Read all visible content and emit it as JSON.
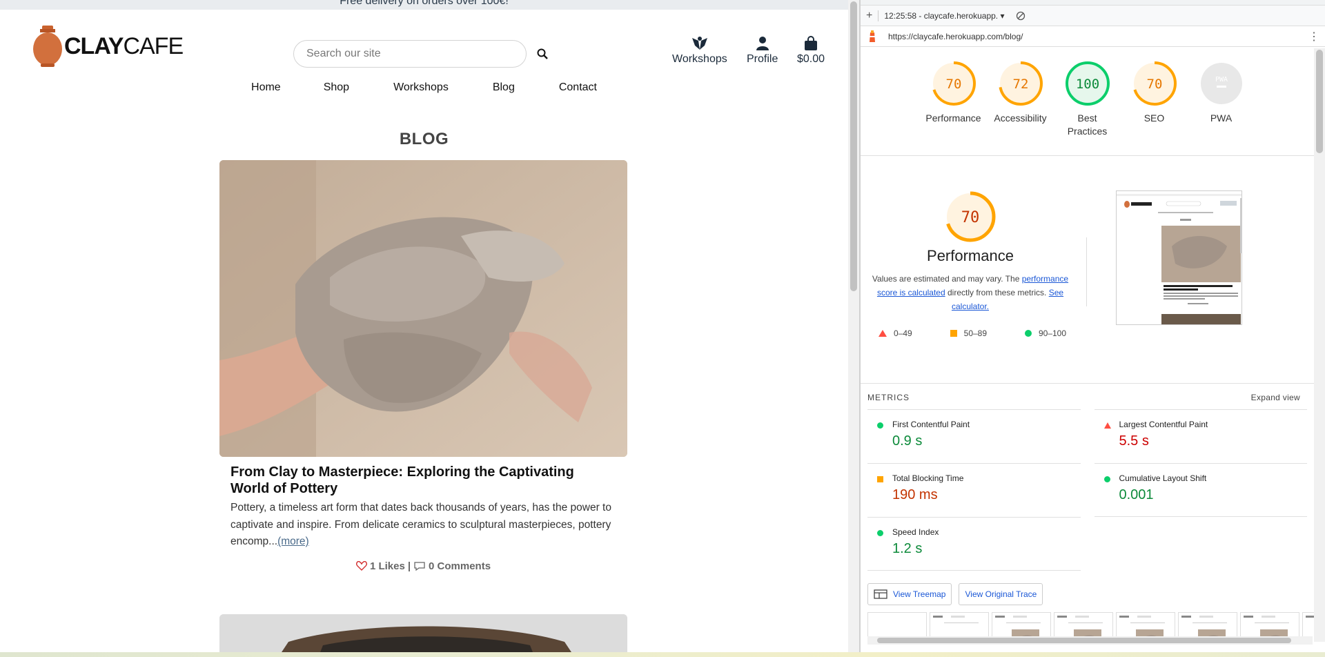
{
  "site": {
    "promo": "Free delivery on orders over 100€!",
    "logo": {
      "bold": "CLAY",
      "thin": "CAFE"
    },
    "search": {
      "placeholder": "Search our site"
    },
    "user_nav": {
      "workshops": "Workshops",
      "profile": "Profile",
      "cart": "$0.00"
    },
    "nav": [
      "Home",
      "Shop",
      "Workshops",
      "Blog",
      "Contact"
    ],
    "page_title": "BLOG",
    "post": {
      "title": "From Clay to Masterpiece: Exploring the Captivating World of Pottery",
      "excerpt": "Pottery, a timeless art form that dates back thousands of years, has the power to captivate and inspire. From delicate ceramics to sculptural masterpieces, pottery encomp...",
      "more": "(more)",
      "likes": "1 Likes",
      "separator": "|",
      "comments": "0 Comments"
    }
  },
  "devtools": {
    "toolbar": {
      "session": "12:25:58 - claycafe.herokuapp."
    },
    "url": "https://claycafe.herokuapp.com/blog/",
    "scores": [
      {
        "label": "Performance",
        "value": "70",
        "color": "#e67700"
      },
      {
        "label": "Accessibility",
        "value": "72",
        "color": "#e67700"
      },
      {
        "label": "Best Practices",
        "value": "100",
        "color": "#0c8a3a"
      },
      {
        "label": "SEO",
        "value": "70",
        "color": "#e67700"
      },
      {
        "label": "PWA",
        "value": "PWA",
        "color": "#9e9e9e"
      }
    ],
    "performance": {
      "score": "70",
      "title": "Performance",
      "desc_1": "Values are estimated and may vary. The ",
      "link_1": "performance score is calculated",
      "desc_2": " directly from these metrics. ",
      "link_2": "See calculator.",
      "legend": [
        "0–49",
        "50–89",
        "90–100"
      ]
    },
    "metrics_title": "METRICS",
    "expand_view": "Expand view",
    "metrics": [
      {
        "label": "First Contentful Paint",
        "value": "0.9 s",
        "status": "pass"
      },
      {
        "label": "Largest Contentful Paint",
        "value": "5.5 s",
        "status": "fail"
      },
      {
        "label": "Total Blocking Time",
        "value": "190 ms",
        "status": "average"
      },
      {
        "label": "Cumulative Layout Shift",
        "value": "0.001",
        "status": "pass"
      },
      {
        "label": "Speed Index",
        "value": "1.2 s",
        "status": "pass"
      }
    ],
    "buttons": {
      "treemap": "View Treemap",
      "trace": "View Original Trace"
    },
    "colors": {
      "pass": "#0c8a3a",
      "average": "#c33300",
      "fail": "#cc0000",
      "orange": "#ffa400",
      "green": "#0cce6b",
      "red": "#ff4e42"
    }
  }
}
